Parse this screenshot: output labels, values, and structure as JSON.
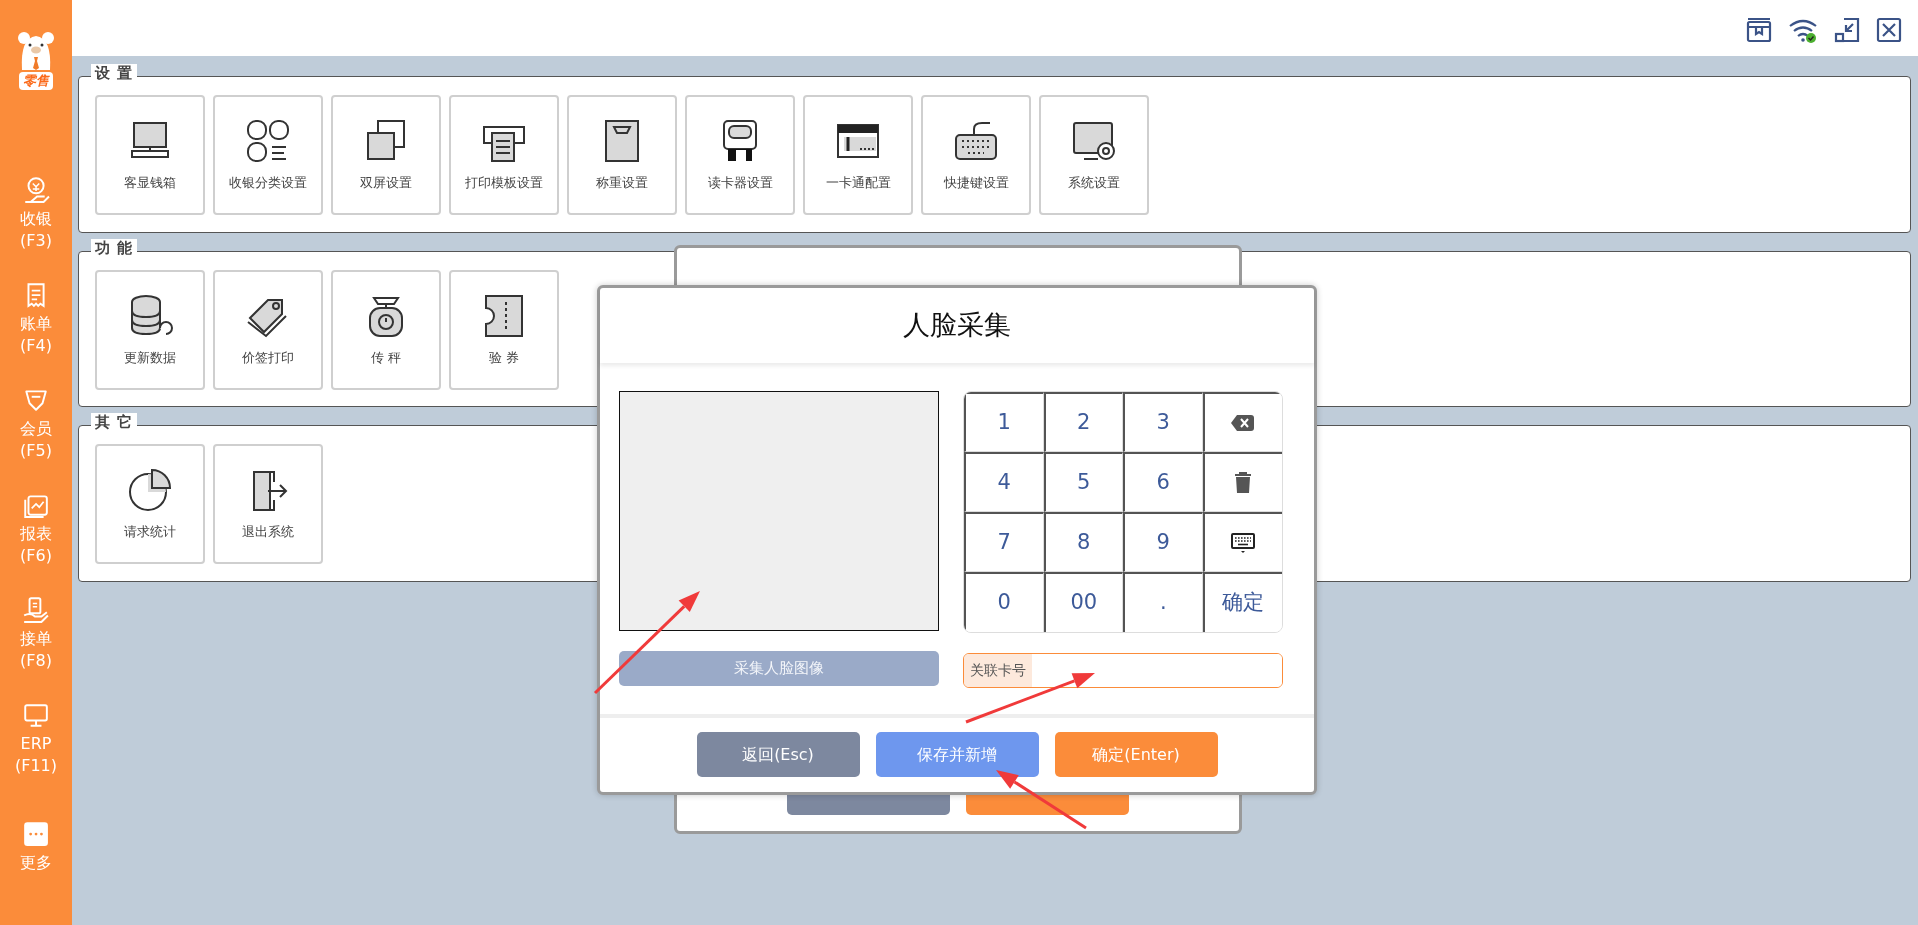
{
  "sidebar": {
    "logo_text": "零售",
    "items": [
      {
        "label": "收银",
        "shortcut": "(F3)"
      },
      {
        "label": "账单",
        "shortcut": "(F4)"
      },
      {
        "label": "会员",
        "shortcut": "(F5)"
      },
      {
        "label": "报表",
        "shortcut": "(F6)"
      },
      {
        "label": "接单",
        "shortcut": "(F8)"
      },
      {
        "label": "ERP",
        "shortcut": "(F11)"
      },
      {
        "label": "更多"
      }
    ]
  },
  "sections": [
    {
      "title": "设 置",
      "tiles": [
        "客显钱箱",
        "收银分类设置",
        "双屏设置",
        "打印模板设置",
        "称重设置",
        "读卡器设置",
        "一卡通配置",
        "快捷键设置",
        "系统设置"
      ]
    },
    {
      "title": "功 能",
      "tiles": [
        "更新数据",
        "价签打印",
        "传 秤",
        "验 券"
      ]
    },
    {
      "title": "其 它",
      "tiles": [
        "请求统计",
        "退出系统"
      ]
    }
  ],
  "back_dialog": {
    "buttons": [
      {
        "kind": "back"
      },
      {
        "kind": "confirm"
      }
    ]
  },
  "dialog": {
    "title": "人脸采集",
    "capture_button": "采集人脸图像",
    "keypad": [
      {
        "kind": "digit",
        "label": "1"
      },
      {
        "kind": "digit",
        "label": "2"
      },
      {
        "kind": "digit",
        "label": "3"
      },
      {
        "kind": "backspace"
      },
      {
        "kind": "digit",
        "label": "4"
      },
      {
        "kind": "digit",
        "label": "5"
      },
      {
        "kind": "digit",
        "label": "6"
      },
      {
        "kind": "clear"
      },
      {
        "kind": "digit",
        "label": "7"
      },
      {
        "kind": "digit",
        "label": "8"
      },
      {
        "kind": "digit",
        "label": "9"
      },
      {
        "kind": "keyboard"
      },
      {
        "kind": "digit",
        "label": "0"
      },
      {
        "kind": "digit",
        "label": "00"
      },
      {
        "kind": "digit",
        "label": "."
      },
      {
        "kind": "confirm",
        "label": "确定"
      }
    ],
    "card_field": {
      "label": "关联卡号"
    },
    "buttons": [
      {
        "kind": "back",
        "label": "返回(Esc)"
      },
      {
        "kind": "save",
        "label": "保存并新增"
      },
      {
        "kind": "confirm",
        "label": "确定(Enter)"
      }
    ]
  }
}
